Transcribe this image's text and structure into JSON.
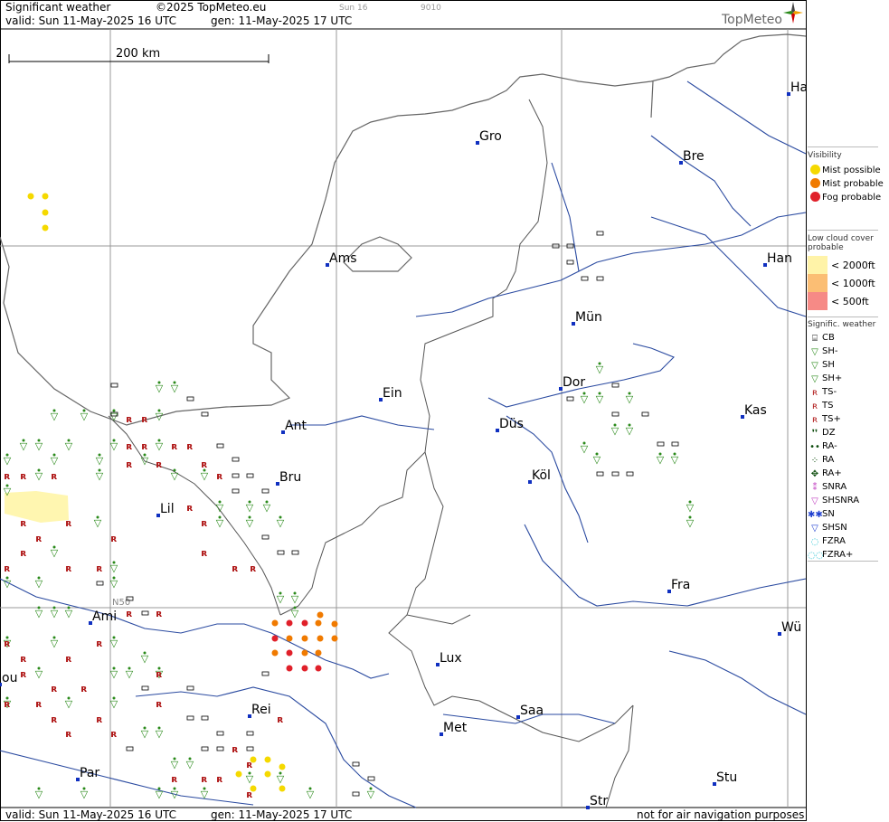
{
  "header": {
    "title": "Significant weather",
    "copyright": "©2025 TopMeteo.eu",
    "frame": "Sun 16",
    "code": "9010",
    "valid": "valid:  Sun  11-May-2025  16 UTC",
    "generated": "gen: 11-May-2025 17 UTC"
  },
  "footer": {
    "valid": "valid:  Sun  11-May-2025  16 UTC",
    "generated": "gen: 11-May-2025 17 UTC",
    "disclaimer": "not for air navigation purposes"
  },
  "brand": {
    "name": "TopMeteo"
  },
  "scale": {
    "label": "200 km"
  },
  "grid_label": "N50",
  "cities": [
    {
      "name": "Gro"
    },
    {
      "name": "Bre"
    },
    {
      "name": "Ams"
    },
    {
      "name": "Han"
    },
    {
      "name": "Mün"
    },
    {
      "name": "Ein"
    },
    {
      "name": "Dor"
    },
    {
      "name": "Kas"
    },
    {
      "name": "Ant"
    },
    {
      "name": "Düs"
    },
    {
      "name": "Bru"
    },
    {
      "name": "Köl"
    },
    {
      "name": "Lil"
    },
    {
      "name": "Fra"
    },
    {
      "name": "Ami"
    },
    {
      "name": "Lux"
    },
    {
      "name": "Wü"
    },
    {
      "name": "Rei"
    },
    {
      "name": "Met"
    },
    {
      "name": "Saa"
    },
    {
      "name": "Par"
    },
    {
      "name": "Stu"
    },
    {
      "name": "Str"
    },
    {
      "name": "Ha"
    },
    {
      "name": "ou"
    }
  ],
  "legend": {
    "visibility": {
      "title": "Visibility",
      "items": [
        {
          "label": "Mist possible",
          "color": "#f5d900"
        },
        {
          "label": "Mist probable",
          "color": "#f07a00"
        },
        {
          "label": "Fog probable",
          "color": "#e0202a"
        }
      ]
    },
    "low_cloud": {
      "title": "Low cloud cover probable",
      "items": [
        {
          "label": "< 2000ft",
          "color": "#fff3a8"
        },
        {
          "label": "< 1000ft",
          "color": "#fbbe74"
        },
        {
          "label": "<   500ft",
          "color": "#f68a86"
        }
      ]
    },
    "signif": {
      "title": "Signific. weather",
      "items": [
        {
          "label": "CB",
          "icon": "cb-icon",
          "color": "#000000"
        },
        {
          "label": "SH-",
          "icon": "shower-light-icon",
          "color": "#2a8a1a"
        },
        {
          "label": "SH",
          "icon": "shower-icon",
          "color": "#2a8a1a"
        },
        {
          "label": "SH+",
          "icon": "shower-heavy-icon",
          "color": "#2a8a1a"
        },
        {
          "label": "TS-",
          "icon": "thunderstorm-light-icon",
          "color": "#b01818"
        },
        {
          "label": "TS",
          "icon": "thunderstorm-icon",
          "color": "#b01818"
        },
        {
          "label": "TS+",
          "icon": "thunderstorm-heavy-icon",
          "color": "#b01818"
        },
        {
          "label": "DZ",
          "icon": "drizzle-icon",
          "color": "#0a4a0a"
        },
        {
          "label": "RA-",
          "icon": "rain-light-icon",
          "color": "#0a4a0a"
        },
        {
          "label": "RA",
          "icon": "rain-icon",
          "color": "#0a4a0a"
        },
        {
          "label": "RA+",
          "icon": "rain-heavy-icon",
          "color": "#0a4a0a"
        },
        {
          "label": "SNRA",
          "icon": "snow-rain-icon",
          "color": "#c040c0"
        },
        {
          "label": "SHSNRA",
          "icon": "snow-rain-shower-icon",
          "color": "#c040c0"
        },
        {
          "label": "SN",
          "icon": "snow-icon",
          "color": "#2040d0"
        },
        {
          "label": "SHSN",
          "icon": "snow-shower-icon",
          "color": "#2040d0"
        },
        {
          "label": "FZRA",
          "icon": "freezing-rain-icon",
          "color": "#20c0d0"
        },
        {
          "label": "FZRA+",
          "icon": "freezing-rain-heavy-icon",
          "color": "#20c0d0"
        }
      ]
    }
  }
}
